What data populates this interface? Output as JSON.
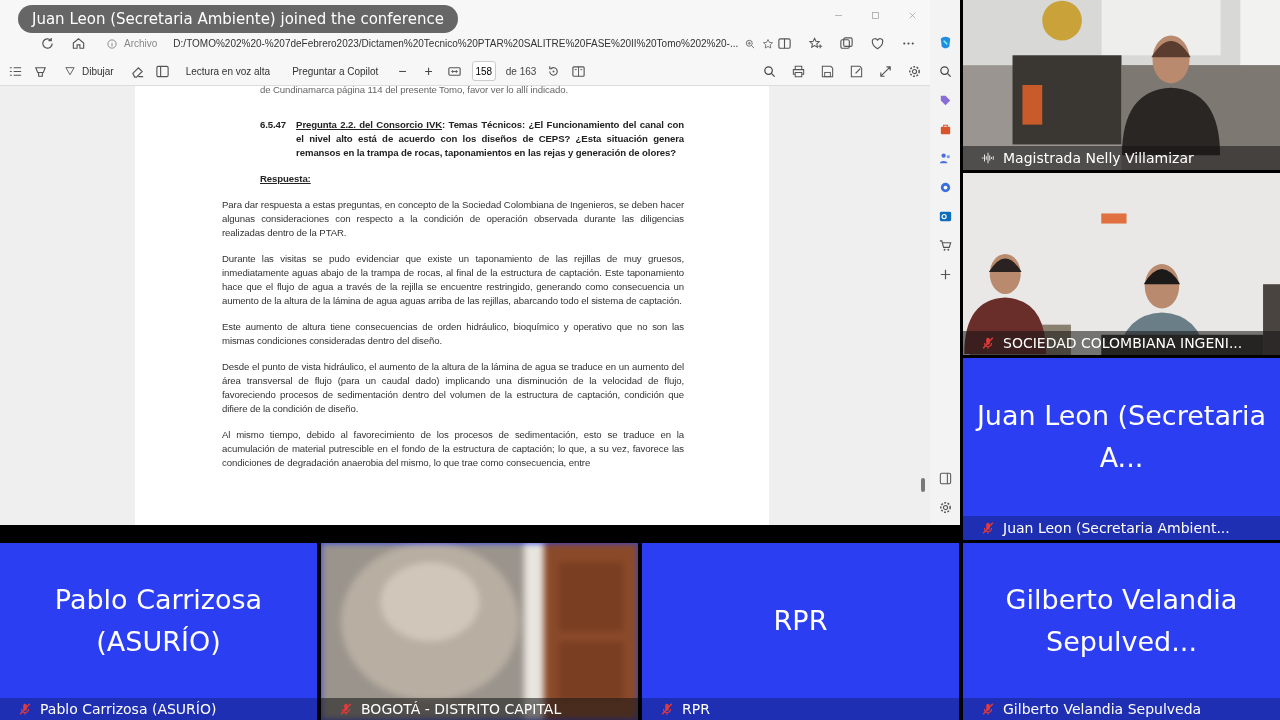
{
  "notification": "Juan Leon (Secretaria Ambiente) joined the conference",
  "browser": {
    "address_label": "Archivo",
    "url": "D:/TOMO%202%20-%207deFebrero2023/Dictamen%20Tecnico%20PTAR%20SALITRE%20FASE%20II%20Tomo%202%20-...",
    "toolbar": {
      "draw": "Dibujar",
      "read_aloud": "Lectura en voz alta",
      "ask": "Preguntar a Copilot",
      "zoom_out": "−",
      "zoom_in": "+",
      "page": "158",
      "page_total": "de 163"
    }
  },
  "document": {
    "top_line": "de Cundinamarca página 114 del presente Tomo, favor ver lo allí indicado.",
    "question": {
      "number": "6.5.47",
      "title": "Pregunta 2.2. del Consorcio IVK",
      "text": ": Temas Técnicos: ¿El Funcionamiento del canal con el nivel alto está de acuerdo con los diseños de CEPS? ¿Esta situación genera remansos en la trampa de rocas, taponamientos en las rejas y generación de olores?"
    },
    "heading": "Respuesta:",
    "paragraphs": [
      "Para dar respuesta a estas preguntas, en concepto de la Sociedad Colombiana de Ingenieros, se deben hacer algunas consideraciones con respecto a la condición de operación observada durante las diligencias realizadas dentro de la PTAR.",
      "Durante las visitas se pudo evidenciar que existe un taponamiento de las rejillas de muy gruesos, inmediatamente aguas abajo de la trampa de rocas, al final de la estructura de captación. Este taponamiento hace que el flujo de agua a través de la rejilla se encuentre restringido, generando como consecuencia un aumento de la altura de la lámina de agua aguas arriba de las rejillas, abarcando todo el sistema de captación.",
      "Este aumento de altura tiene consecuencias de orden hidráulico, bioquímico y operativo que no son las mismas condiciones consideradas dentro del diseño.",
      "Desde el punto de vista hidráulico, el aumento de la altura de la lámina de agua se traduce en un aumento del área transversal de flujo (para un caudal dado) implicando una disminución de la velocidad de flujo, favoreciendo procesos de sedimentación dentro del volumen de la estructura de captación, condición que difiere de la condición de diseño.",
      "Al mismo tiempo, debido al favorecimiento de los procesos de sedimentación, esto se traduce en la acumulación de material putrescible en el fondo de la estructura de captación; lo que, a su vez, favorece las condiciones de degradación anaerobia del mismo, lo que trae como consecuencia, entre"
    ]
  },
  "side_tiles": [
    {
      "kind": "picture",
      "label": "Magistrada Nelly Villamizar",
      "muted": false
    },
    {
      "kind": "picture",
      "label": "SOCIEDAD COLOMBIANA INGENI...",
      "muted": true
    },
    {
      "kind": "avatar",
      "display_name": "Juan Leon (Secretaria A...",
      "label": "Juan Leon (Secretaria Ambient...",
      "muted": true
    }
  ],
  "bottom_tiles": [
    {
      "kind": "avatar",
      "display_name": "Pablo Carrizosa (ASURÍO)",
      "label": "Pablo Carrizosa (ASURÍO)",
      "muted": true
    },
    {
      "kind": "picture",
      "label": "BOGOTÁ - DISTRITO CAPITAL",
      "muted": true
    },
    {
      "kind": "avatar",
      "display_name": "RPR",
      "label": "RPR",
      "muted": true
    },
    {
      "kind": "avatar",
      "display_name": "Gilberto Velandia Sepulved...",
      "label": "Gilberto Velandia Sepulveda",
      "muted": true
    }
  ]
}
